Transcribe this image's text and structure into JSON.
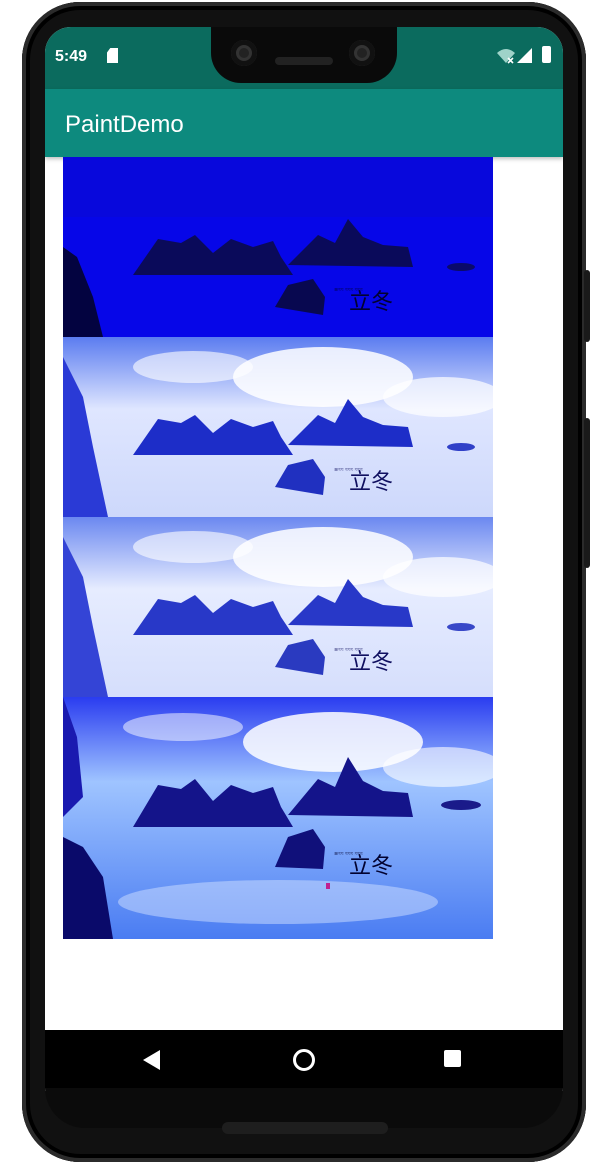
{
  "status_bar": {
    "time": "5:49",
    "icons": [
      "sd-card-icon",
      "wifi-icon",
      "signal-icon",
      "battery-icon"
    ]
  },
  "app_bar": {
    "title": "PaintDemo",
    "color": "#0d8a7e"
  },
  "images": {
    "items": [
      {
        "label": "立冬",
        "filter": "blue-dark",
        "tint": "#0000ff"
      },
      {
        "label": "立冬",
        "filter": "light",
        "tint": "#c8d8ff"
      },
      {
        "label": "立冬",
        "filter": "light",
        "tint": "#c8d8ff"
      },
      {
        "label": "立冬",
        "filter": "blue-original",
        "tint": "#2233ff"
      }
    ]
  },
  "nav_bar": {
    "buttons": [
      "back-icon",
      "home-icon",
      "recent-apps-icon"
    ]
  }
}
